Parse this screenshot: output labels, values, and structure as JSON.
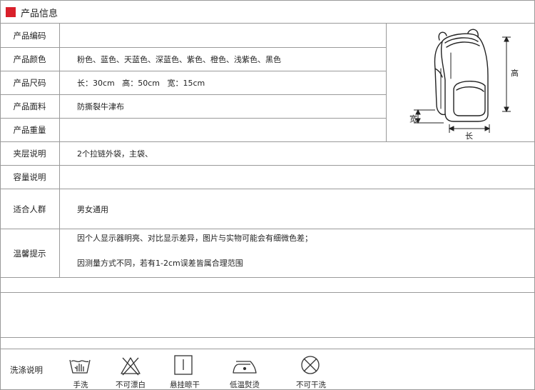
{
  "header": {
    "title": "产品信息"
  },
  "rows": [
    {
      "label": "产品编码",
      "value": ""
    },
    {
      "label": "产品颜色",
      "value": "粉色、蓝色、天蓝色、深蓝色、紫色、橙色、浅紫色、黑色"
    },
    {
      "label": "产品尺码",
      "value": "长：30cm   高：50cm   宽：15cm"
    },
    {
      "label": "产品面料",
      "value": "防撕裂牛津布"
    },
    {
      "label": "产品重量",
      "value": ""
    },
    {
      "label": "夹层说明",
      "value": "2个拉链外袋，主袋、"
    },
    {
      "label": "容量说明",
      "value": ""
    },
    {
      "label": "适合人群",
      "value": "男女通用"
    },
    {
      "label": "温馨提示",
      "value_lines": [
        "因个人显示器明亮、对比显示差异，图片与实物可能会有细微色差；",
        "因测量方式不同，若有1-2cm误差皆属合理范围"
      ]
    }
  ],
  "diagram": {
    "height_label": "高",
    "width_label": "宽",
    "length_label": "长"
  },
  "care": {
    "title": "洗涤说明",
    "items": [
      {
        "icon": "hand-wash-icon",
        "label": "手洗"
      },
      {
        "icon": "no-bleach-icon",
        "label": "不可漂白"
      },
      {
        "icon": "hang-dry-icon",
        "label": "悬挂晾干"
      },
      {
        "icon": "low-iron-icon",
        "label": "低温熨烫"
      },
      {
        "icon": "no-dry-clean-icon",
        "label": "不可干洗"
      }
    ]
  }
}
